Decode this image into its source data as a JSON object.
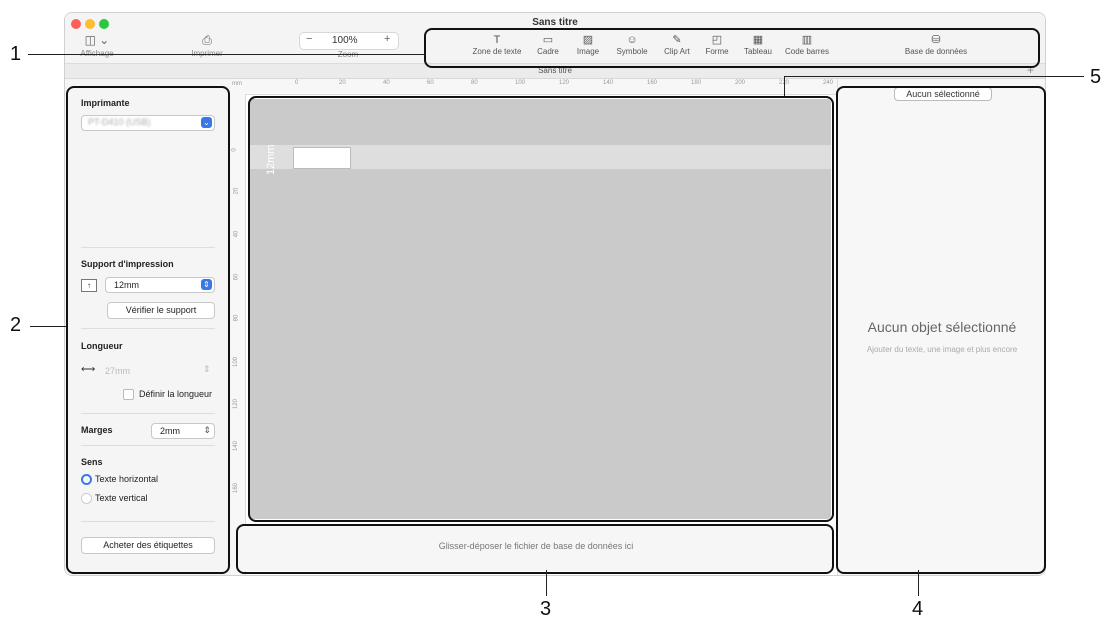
{
  "window": {
    "title": "Sans titre",
    "tab_title": "Sans titre",
    "tab_add": "+"
  },
  "toolbar_left": {
    "view_icon": "◫ ⌄",
    "view_label": "Affichage",
    "print_icon": "⎙",
    "print_label": "Imprimer",
    "zoom_minus": "−",
    "zoom_value": "100%",
    "zoom_plus": "+",
    "zoom_label": "Zoom"
  },
  "tools": [
    {
      "icon": "T",
      "label": "Zone de texte"
    },
    {
      "icon": "▭",
      "label": "Cadre"
    },
    {
      "icon": "▨",
      "label": "Image"
    },
    {
      "icon": "☺",
      "label": "Symbole"
    },
    {
      "icon": "✎",
      "label": "Clip Art"
    },
    {
      "icon": "◰",
      "label": "Forme"
    },
    {
      "icon": "▦",
      "label": "Tableau"
    },
    {
      "icon": "▥",
      "label": "Code barres"
    },
    {
      "icon": "⛁",
      "label": "Base de données"
    }
  ],
  "sidebar": {
    "printer_title": "Imprimante",
    "printer_value": "PT-D410 (USB)",
    "media_title": "Support d'impression",
    "media_value": "12mm",
    "check_media": "Vérifier le support",
    "length_title": "Longueur",
    "length_value": "27mm",
    "set_length": "Définir la longueur",
    "margins_title": "Marges",
    "margins_value": "2mm",
    "direction_title": "Sens",
    "horizontal": "Texte horizontal",
    "vertical": "Texte vertical",
    "buy_labels": "Acheter des étiquettes"
  },
  "ruler": {
    "unit": "mm",
    "h_ticks": [
      "0",
      "20",
      "40",
      "60",
      "80",
      "100",
      "120",
      "140",
      "160",
      "180",
      "200",
      "220",
      "240"
    ],
    "v_ticks": [
      "0",
      "20",
      "40",
      "60",
      "80",
      "100",
      "120",
      "140",
      "160"
    ]
  },
  "canvas": {
    "tape_width": "12mm"
  },
  "dropzone": {
    "text": "Glisser-déposer le fichier de base de données ici"
  },
  "right_panel": {
    "badge": "Aucun sélectionné",
    "title": "Aucun objet sélectionné",
    "subtitle": "Ajouter du texte, une image et plus encore"
  },
  "callouts": [
    "1",
    "2",
    "3",
    "4",
    "5"
  ]
}
